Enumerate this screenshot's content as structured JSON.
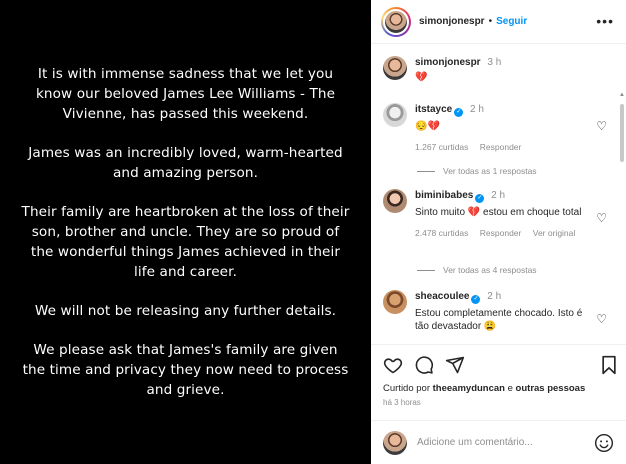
{
  "post_image": {
    "paragraphs": [
      "It is with immense sadness that we let you know our beloved James Lee Williams - The Vivienne, has passed this weekend.",
      "James was an incredibly loved, warm-hearted and amazing person.",
      "Their family are heartbroken at the loss of their son, brother and uncle. They are so proud of the wonderful things James achieved in their life and career.",
      "We will not be releasing any further details.",
      "We please ask that James's family are given the time and privacy they now need to process and grieve."
    ]
  },
  "header": {
    "username": "simonjonespr",
    "separator": "•",
    "follow_label": "Seguir",
    "more_icon": "more-icon"
  },
  "caption": {
    "username": "simonjonespr",
    "time": "3 h",
    "text": "💔"
  },
  "comments": [
    {
      "username": "itstayce",
      "verified": true,
      "time": "2 h",
      "text": "😔💔",
      "likes": "1.267 curtidas",
      "reply_label": "Responder",
      "translate_label": "",
      "replies_label": "Ver todas as 1 respostas"
    },
    {
      "username": "biminibabes",
      "verified": true,
      "time": "2 h",
      "text": "Sinto muito 💔 estou em choque total",
      "likes": "2.478 curtidas",
      "reply_label": "Responder",
      "translate_label": "Ver original",
      "replies_label": "Ver todas as 4 respostas"
    },
    {
      "username": "sheacoulee",
      "verified": true,
      "time": "2 h",
      "text": "Estou completamente chocado. Isto é tão devastador 😩",
      "likes": "",
      "reply_label": "",
      "translate_label": "",
      "replies_label": ""
    }
  ],
  "actions": {
    "like_icon": "heart-icon",
    "comment_icon": "comment-icon",
    "share_icon": "share-icon",
    "save_icon": "bookmark-icon"
  },
  "liked_by": {
    "prefix": "Curtido por",
    "user": "theeamyduncan",
    "connector": "e",
    "others": "outras pessoas"
  },
  "ago": "há 3 horas",
  "comment_input": {
    "placeholder": "Adicione um comentário..."
  },
  "colors": {
    "accent": "#0095f6",
    "image_bg": "#000000",
    "secondary_text": "#8e8e8e"
  }
}
